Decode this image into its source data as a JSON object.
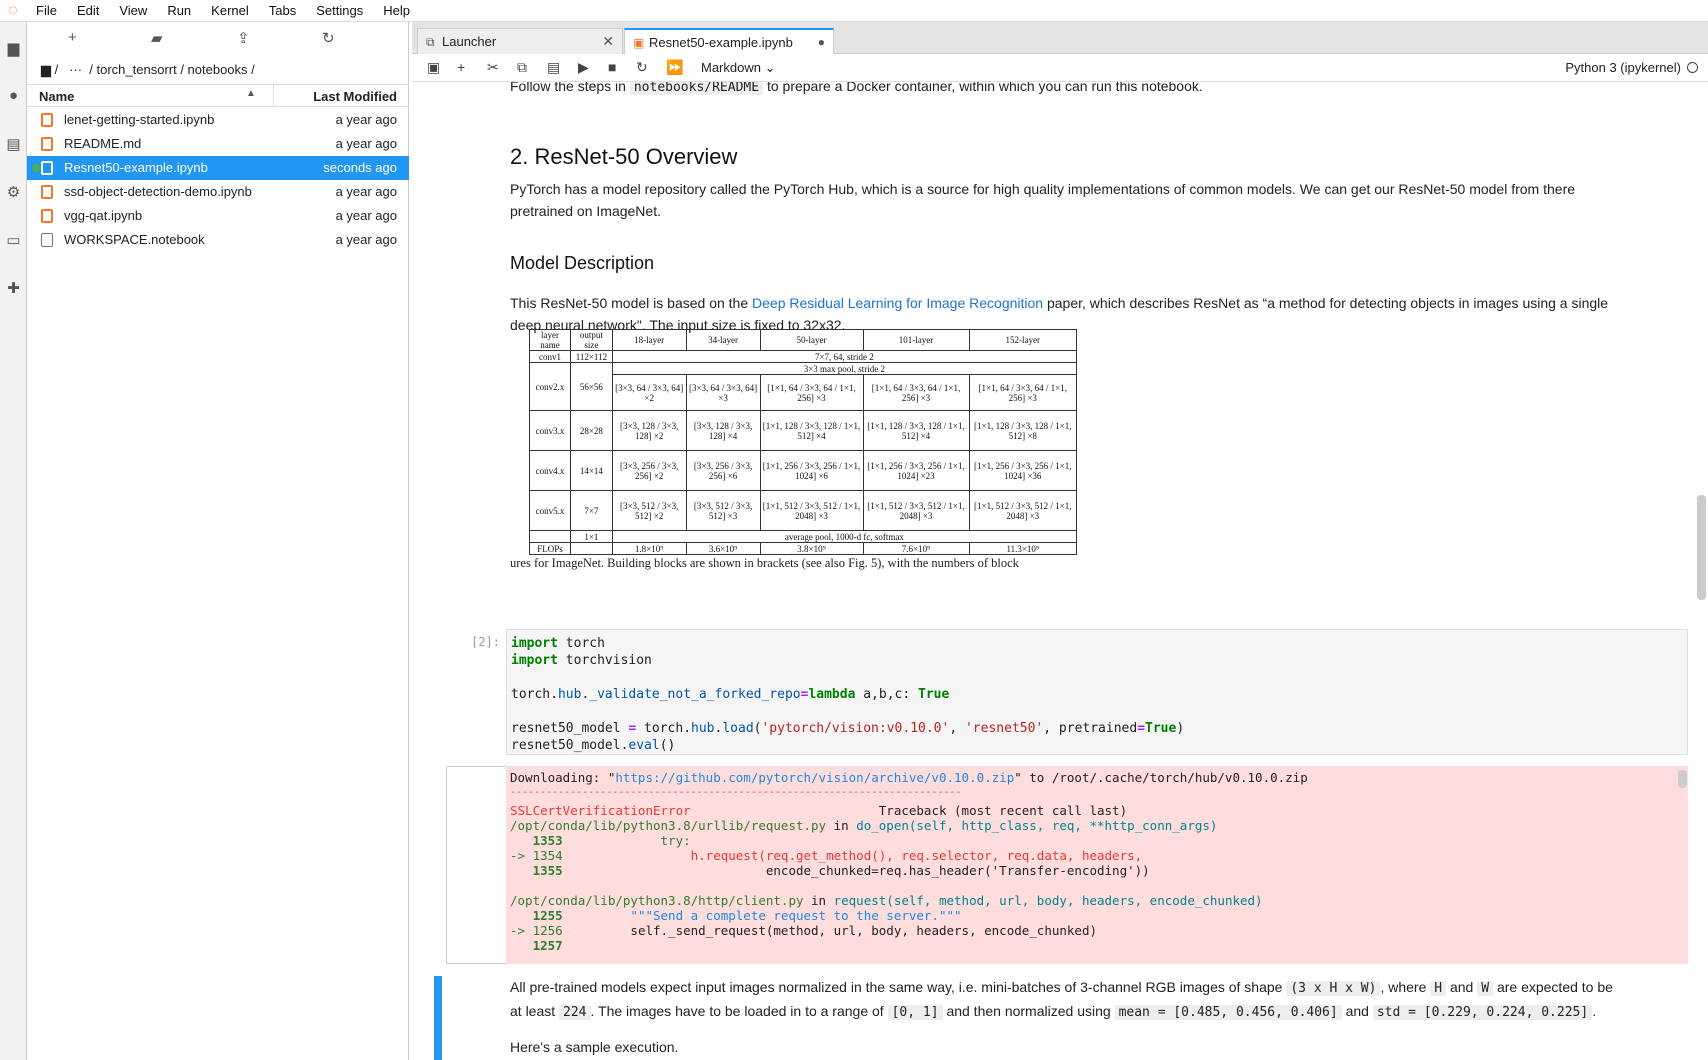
{
  "menu": [
    "File",
    "Edit",
    "View",
    "Run",
    "Kernel",
    "Tabs",
    "Settings",
    "Help"
  ],
  "filebrowser": {
    "breadcrumb": "/   ···  / torch_tensorrt / notebooks /",
    "col_name": "Name",
    "col_modified": "Last Modified",
    "files": [
      {
        "name": "lenet-getting-started.ipynb",
        "modified": "a year ago"
      },
      {
        "name": "README.md",
        "modified": "a year ago"
      },
      {
        "name": "Resnet50-example.ipynb",
        "modified": "seconds ago"
      },
      {
        "name": "ssd-object-detection-demo.ipynb",
        "modified": "a year ago"
      },
      {
        "name": "vgg-qat.ipynb",
        "modified": "a year ago"
      },
      {
        "name": "WORKSPACE.notebook",
        "modified": "a year ago"
      }
    ]
  },
  "tabs": [
    {
      "label": "Launcher"
    },
    {
      "label": "Resnet50-example.ipynb"
    }
  ],
  "toolbar": {
    "cell_type": "Markdown",
    "kernel": "Python 3 (ipykernel)"
  },
  "notebook": {
    "p_follow_a": "Follow the steps in",
    "p_follow_code": "notebooks/README",
    "p_follow_b": "to prepare a Docker container, within which you can run this notebook.",
    "h2": "2. ResNet-50 Overview",
    "p_hub": "PyTorch has a model repository called the PyTorch Hub, which is a source for high quality implementations of common models. We can get our ResNet-50 model from there",
    "p_hub2": "pretrained on ImageNet.",
    "h3": "Model Description",
    "p_desc_a": "This ResNet-50 model is based on the",
    "p_desc_link": "Deep Residual Learning for Image Recognition",
    "p_desc_b": "paper, which describes ResNet as “a method for detecting objects in images using a single",
    "p_desc2": "deep neural network\". The input size is fixed to 32x32.",
    "table_caption": "ures for ImageNet. Building blocks are shown in brackets (see also Fig. 5), with the numbers of block",
    "prompt": "[2]:",
    "code": {
      "l1a": "import",
      "l1b": " torch",
      "l2a": "import",
      "l2b": " torchvision",
      "l4a": "torch.",
      "l4b": "hub",
      "l4c": ".",
      "l4d": "_validate_not_a_forked_repo",
      "l4e": "=",
      "l4f": "lambda",
      "l4g": " a,b,c: ",
      "l4h": "True",
      "l6a": "resnet50_model ",
      "l6b": "=",
      "l6c": " torch.",
      "l6d": "hub",
      "l6e": ".",
      "l6f": "load",
      "l6g": "(",
      "l6h": "'pytorch/vision:v0.10.0'",
      "l6i": ", ",
      "l6j": "'resnet50'",
      "l6k": ", pretrained",
      "l6l": "=",
      "l6m": "True",
      "l6n": ")",
      "l7a": "resnet50_model.",
      "l7b": "eval",
      "l7c": "()"
    },
    "output": {
      "o1a": "Downloading: \"",
      "o1b": "https://github.com/pytorch/vision/archive/v0.10.0.zip",
      "o1c": "\" to /root/.cache/torch/hub/v0.10.0.zip",
      "o2": "---------------------------------------------------------------------------",
      "o3a": "SSLCertVerificationError",
      "o3b": "                         Traceback (most recent call last)",
      "o4a": "/opt/conda/lib/python3.8/urllib/request.py",
      "o4b": " in ",
      "o4c": "do_open(self, http_class, req, **http_conn_args)",
      "o5a": "   1353",
      "o5b": "             try:",
      "o6a": "-> 1354",
      "o6b": "                 h.request(req.get_method(), req.selector, req.data, headers,",
      "o7a": "   1355",
      "o7b": "                           encode_chunked=req.has_header('Transfer-encoding'))",
      "o9a": "/opt/conda/lib/python3.8/http/client.py",
      "o9b": " in ",
      "o9c": "request(self, method, url, body, headers, encode_chunked)",
      "o10a": "   1255",
      "o10b": "         \"\"\"Send a complete request to the server.\"\"\"",
      "o11a": "-> 1256",
      "o11b": "         self._send_request(method, url, body, headers, encode_chunked)",
      "o12a": "   1257"
    },
    "p_norm_a": "All pre-trained models expect input images normalized in the same way, i.e. mini-batches of 3-channel RGB images of shape",
    "p_norm_c1": "(3 x H x W)",
    "p_norm_b": ", where",
    "p_norm_c2": "H",
    "p_norm_and": "and",
    "p_norm_c3": "W",
    "p_norm_d": "are expected to be",
    "p_norm2_a": "at least",
    "p_norm2_c1": "224",
    "p_norm2_b": ". The images have to be loaded in to a range of",
    "p_norm2_c2": "[0, 1]",
    "p_norm2_c": "and then normalized using",
    "p_norm2_c3": "mean = [0.485, 0.456, 0.406]",
    "p_norm2_and": "and",
    "p_norm2_c4": "std = [0.229, 0.224, 0.225]",
    "p_norm2_end": ".",
    "p_sample": "Here's a sample execution."
  },
  "table": {
    "header": [
      "layer name",
      "output size",
      "18-layer",
      "34-layer",
      "50-layer",
      "101-layer",
      "152-layer"
    ],
    "conv1": [
      "conv1",
      "112×112",
      "7×7, 64, stride 2"
    ],
    "pool": "3×3 max pool, stride 2",
    "rows": [
      {
        "name": "conv2.x",
        "size": "56×56",
        "c18": "[3×3, 64 / 3×3, 64] ×2",
        "c34": "[3×3, 64 / 3×3, 64] ×3",
        "c50": "[1×1, 64 / 3×3, 64 / 1×1, 256] ×3",
        "c101": "[1×1, 64 / 3×3, 64 / 1×1, 256] ×3",
        "c152": "[1×1, 64 / 3×3, 64 / 1×1, 256] ×3"
      },
      {
        "name": "conv3.x",
        "size": "28×28",
        "c18": "[3×3, 128 / 3×3, 128] ×2",
        "c34": "[3×3, 128 / 3×3, 128] ×4",
        "c50": "[1×1, 128 / 3×3, 128 / 1×1, 512] ×4",
        "c101": "[1×1, 128 / 3×3, 128 / 1×1, 512] ×4",
        "c152": "[1×1, 128 / 3×3, 128 / 1×1, 512] ×8"
      },
      {
        "name": "conv4.x",
        "size": "14×14",
        "c18": "[3×3, 256 / 3×3, 256] ×2",
        "c34": "[3×3, 256 / 3×3, 256] ×6",
        "c50": "[1×1, 256 / 3×3, 256 / 1×1, 1024] ×6",
        "c101": "[1×1, 256 / 3×3, 256 / 1×1, 1024] ×23",
        "c152": "[1×1, 256 / 3×3, 256 / 1×1, 1024] ×36"
      },
      {
        "name": "conv5.x",
        "size": "7×7",
        "c18": "[3×3, 512 / 3×3, 512] ×2",
        "c34": "[3×3, 512 / 3×3, 512] ×3",
        "c50": "[1×1, 512 / 3×3, 512 / 1×1, 2048] ×3",
        "c101": "[1×1, 512 / 3×3, 512 / 1×1, 2048] ×3",
        "c152": "[1×1, 512 / 3×3, 512 / 1×1, 2048] ×3"
      }
    ],
    "avg": [
      "1×1",
      "average pool, 1000-d fc, softmax"
    ],
    "flops": [
      "FLOPs",
      "1.8×10⁹",
      "3.6×10⁹",
      "3.8×10⁹",
      "7.6×10⁹",
      "11.3×10⁹"
    ]
  }
}
